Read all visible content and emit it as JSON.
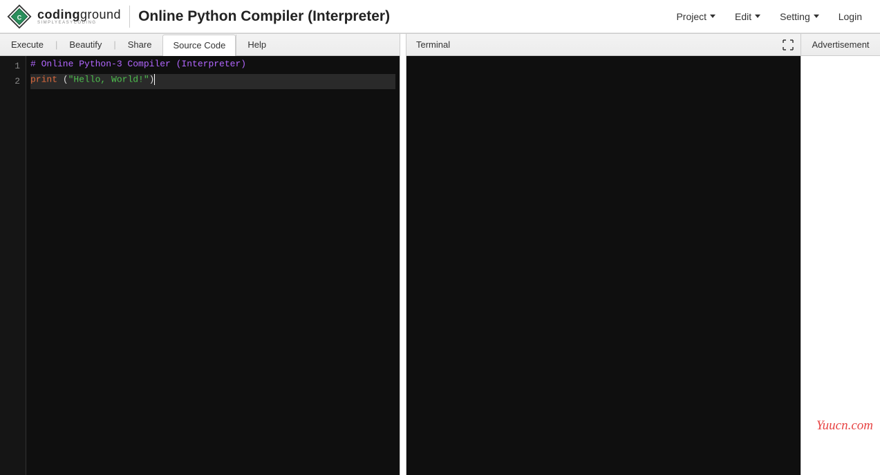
{
  "brand": {
    "bold": "coding",
    "rest": "ground",
    "tagline": "SIMPLYEASYCODING"
  },
  "page_title": "Online Python Compiler (Interpreter)",
  "menu": {
    "project": "Project",
    "edit": "Edit",
    "setting": "Setting",
    "login": "Login"
  },
  "toolbar": {
    "execute": "Execute",
    "beautify": "Beautify",
    "share": "Share",
    "source_tab": "Source Code",
    "help": "Help"
  },
  "editor": {
    "lines": [
      "1",
      "2"
    ],
    "comment": "# Online Python-3 Compiler (Interpreter)",
    "keyword": "print",
    "paren_open": " (",
    "string": "\"Hello, World!\"",
    "paren_close": ")"
  },
  "terminal": {
    "title": "Terminal"
  },
  "ad": {
    "title": "Advertisement"
  },
  "watermark": "Yuucn.com"
}
